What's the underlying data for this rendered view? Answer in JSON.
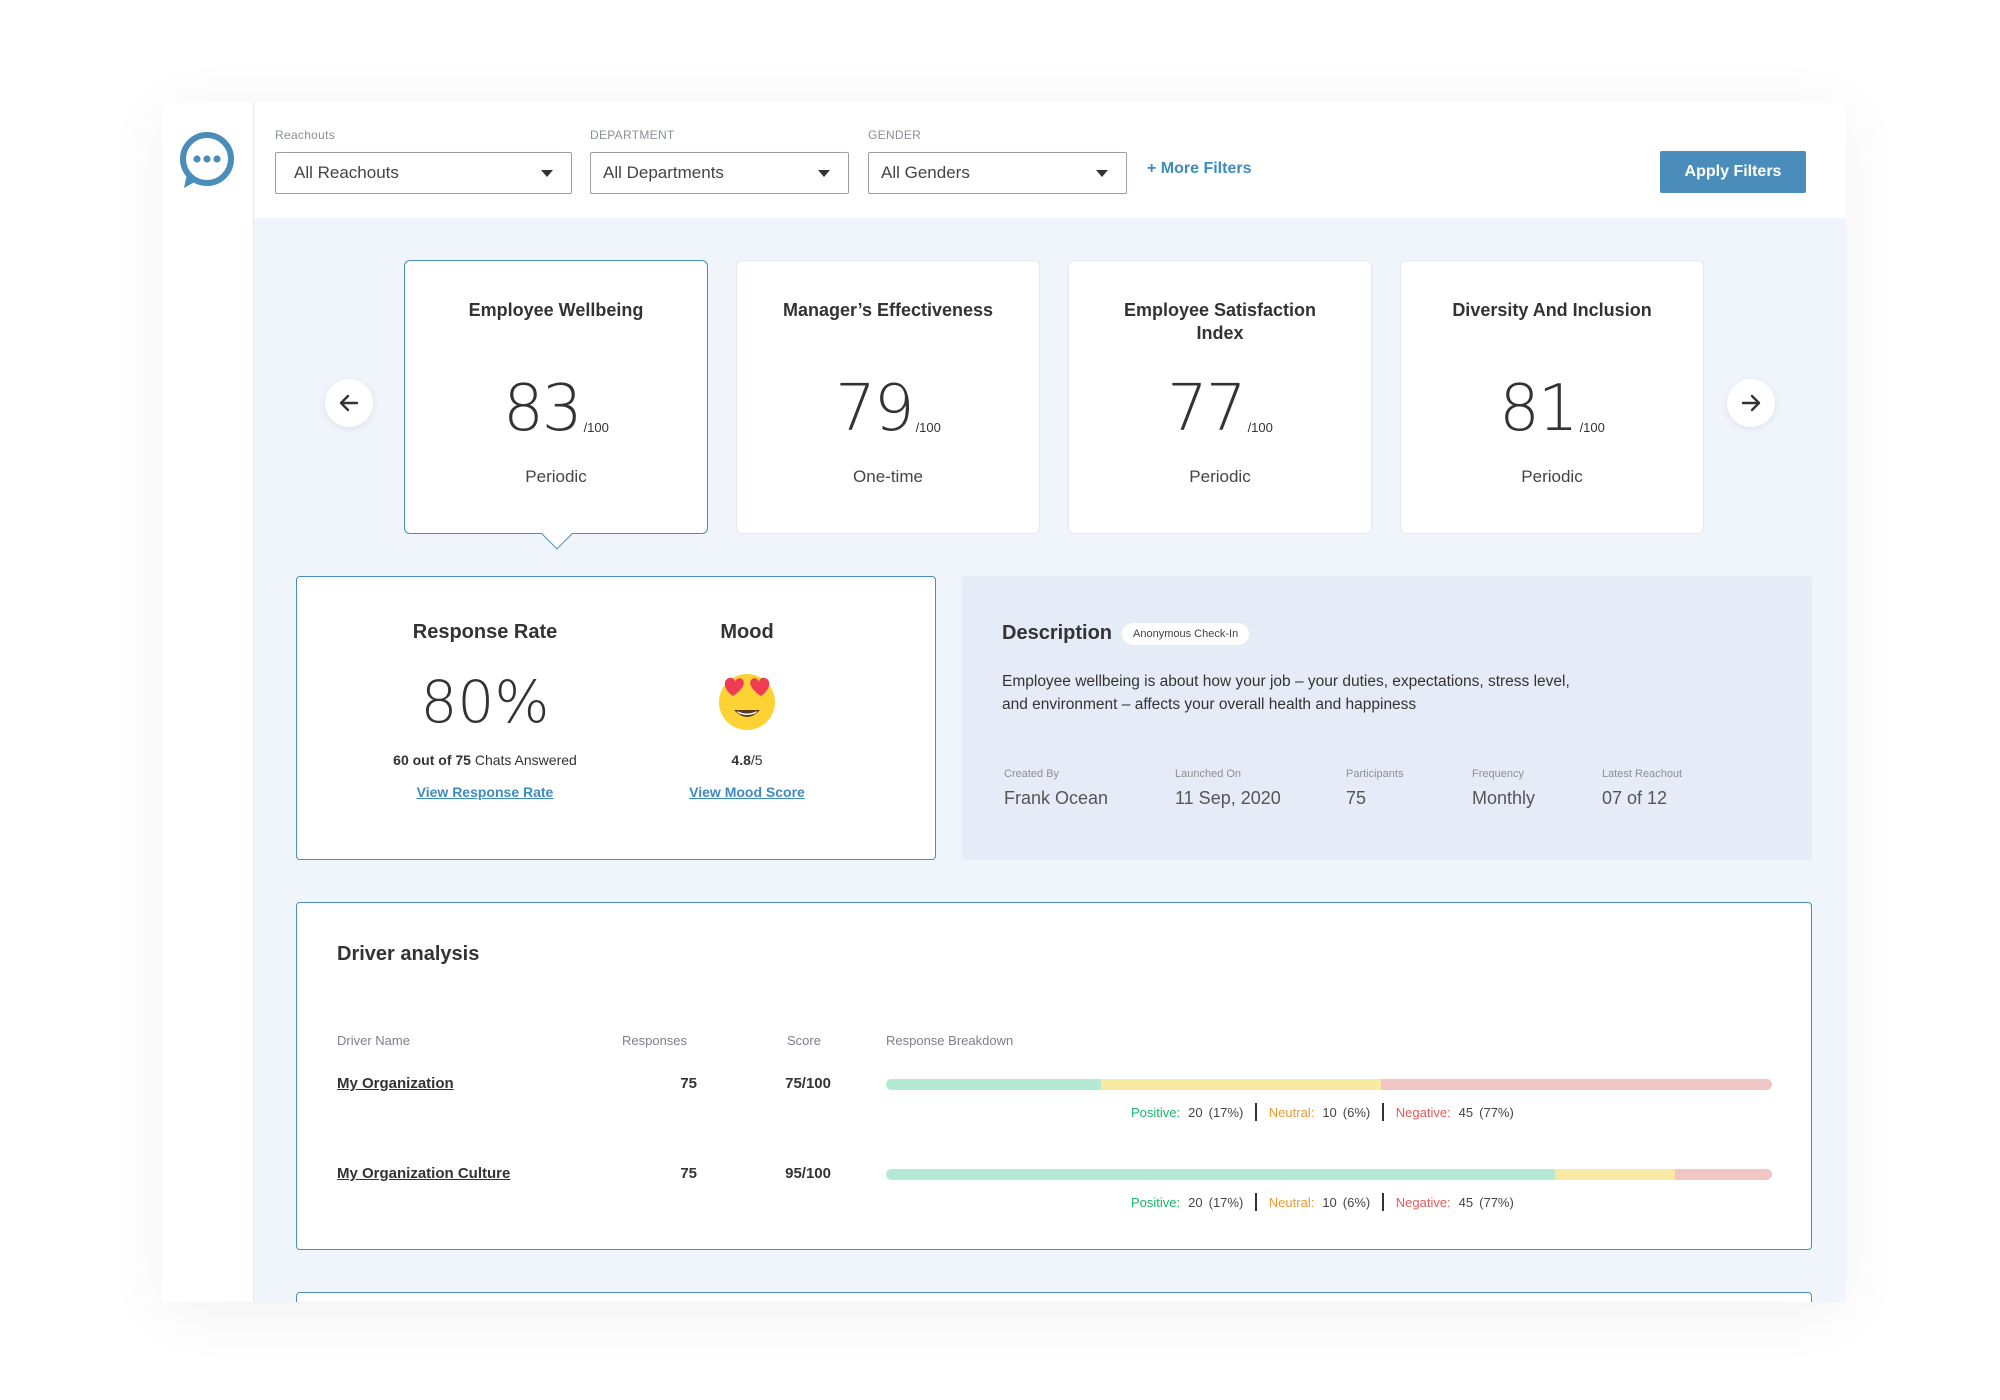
{
  "filters": [
    {
      "label": "Reachouts",
      "value": "All Reachouts"
    },
    {
      "label": "DEPARTMENT",
      "value": "All Departments"
    },
    {
      "label": "GENDER",
      "value": "All Genders"
    }
  ],
  "more_filters": "+ More Filters",
  "apply_filters": "Apply Filters",
  "metrics": [
    {
      "title": "Employee Wellbeing",
      "score": "83",
      "out_of": "/100",
      "type": "Periodic",
      "active": true
    },
    {
      "title": "Manager’s Effectiveness",
      "score": "79",
      "out_of": "/100",
      "type": "One-time"
    },
    {
      "title": "Employee Satisfaction Index",
      "score": "77",
      "out_of": "/100",
      "type": "Periodic"
    },
    {
      "title": "Diversity And Inclusion",
      "score": "81",
      "out_of": "/100",
      "type": "Periodic"
    }
  ],
  "response": {
    "title": "Response Rate",
    "value": "80%",
    "detail_bold": "60 out of 75",
    "detail_rest": " Chats Answered",
    "link": "View Response Rate"
  },
  "mood": {
    "title": "Mood",
    "score_bold": "4.8",
    "score_rest": "/5",
    "link": "View Mood Score",
    "icon": "heart-eyes-emoji"
  },
  "description": {
    "title": "Description",
    "badge": "Anonymous Check-In",
    "line1": "Employee wellbeing is about how your job – your duties, expectations, stress level,",
    "line2": "and environment – affects your overall health and happiness",
    "meta": [
      {
        "label": "Created By",
        "value": "Frank Ocean"
      },
      {
        "label": "Launched On",
        "value": "11 Sep, 2020"
      },
      {
        "label": "Participants",
        "value": "75"
      },
      {
        "label": "Frequency",
        "value": "Monthly"
      },
      {
        "label": "Latest Reachout",
        "value": "07 of 12"
      }
    ]
  },
  "drivers": {
    "title": "Driver analysis",
    "headers": [
      "Driver Name",
      "Responses",
      "Score",
      "Response Breakdown"
    ],
    "legend_labels": {
      "positive": "Positive:",
      "neutral": "Neutral:",
      "negative": "Negative:"
    },
    "rows": [
      {
        "name": "My Organization",
        "responses": "75",
        "score": "75/100",
        "bar_fractions": {
          "positive": 0.243,
          "neutral": 0.316,
          "negative": 0.441
        },
        "positive": {
          "count": "20",
          "pct": "(17%)"
        },
        "neutral": {
          "count": "10",
          "pct": "(6%)"
        },
        "negative": {
          "count": "45",
          "pct": "(77%)"
        }
      },
      {
        "name": "My Organization Culture",
        "responses": "75",
        "score": "95/100",
        "bar_fractions": {
          "positive": 0.755,
          "neutral": 0.136,
          "negative": 0.109
        },
        "positive": {
          "count": "20",
          "pct": "(17%)"
        },
        "neutral": {
          "count": "10",
          "pct": "(6%)"
        },
        "negative": {
          "count": "45",
          "pct": "(77%)"
        }
      }
    ]
  },
  "colors": {
    "accent": "#4a8dbb",
    "positive": "#19b56a",
    "neutral": "#eb9b2e",
    "negative": "#e35a5a"
  }
}
